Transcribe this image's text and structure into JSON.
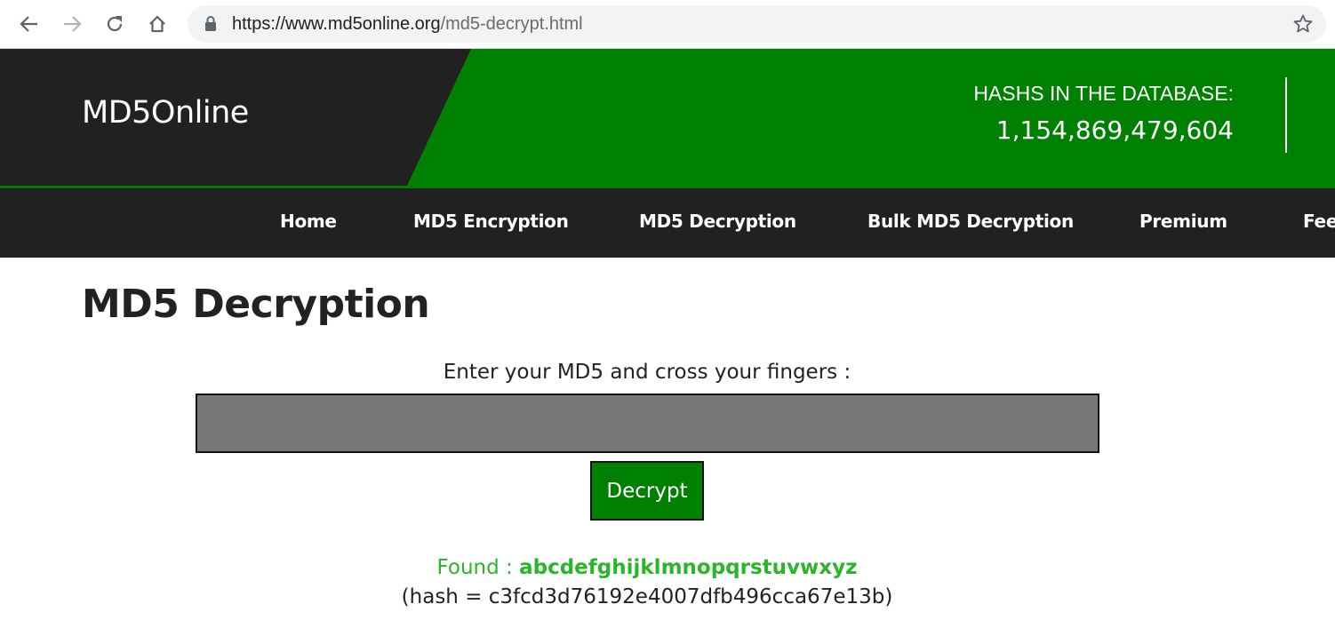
{
  "browser": {
    "url_host": "https://www.md5online.org",
    "url_path": "/md5-decrypt.html"
  },
  "header": {
    "logo": "MD5Online",
    "stats_label": "HASHS IN THE DATABASE:",
    "stats_value": "1,154,869,479,604",
    "brand_color": "#008000",
    "dark_color": "#212121"
  },
  "nav": {
    "items": [
      {
        "label": "Home"
      },
      {
        "label": "MD5 Encryption"
      },
      {
        "label": "MD5 Decryption"
      },
      {
        "label": "Bulk MD5 Decryption"
      },
      {
        "label": "Premium"
      },
      {
        "label": "Fee"
      }
    ]
  },
  "main": {
    "title": "MD5 Decryption",
    "prompt": "Enter your MD5 and cross your fingers :",
    "input_value": "",
    "button_label": "Decrypt",
    "result_prefix": "Found : ",
    "result_value": "abcdefghijklmnopqrstuvwxyz",
    "hash_line": "(hash = c3fcd3d76192e4007dfb496cca67e13b)",
    "found_color": "#2ab52a"
  },
  "icons": {
    "back": "arrow-left-icon",
    "forward": "arrow-right-icon",
    "reload": "reload-icon",
    "home": "home-icon",
    "lock": "lock-icon",
    "star": "star-icon"
  }
}
